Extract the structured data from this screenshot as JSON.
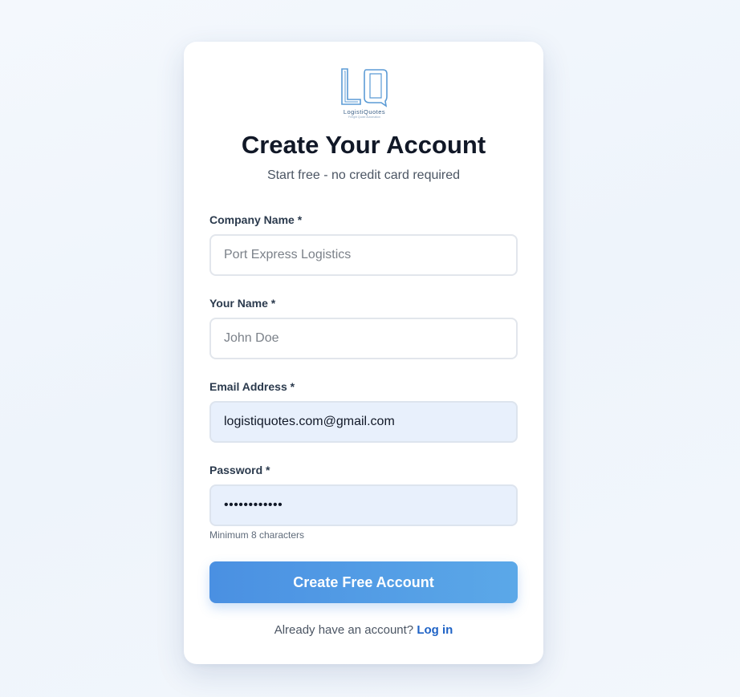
{
  "brand": {
    "logo_icon": "lq-monogram-logo",
    "logo_text": "LogistiQuotes",
    "logo_tagline": "Freight Quote Automation",
    "colors": {
      "logo": "#5b9bd5",
      "primary": "#4a90e2",
      "link": "#1f63c6"
    }
  },
  "header": {
    "title": "Create Your Account",
    "subtitle": "Start free - no credit card required"
  },
  "form": {
    "company": {
      "label": "Company Name",
      "required_mark": "*",
      "placeholder": "Port Express Logistics",
      "value": ""
    },
    "name": {
      "label": "Your Name",
      "required_mark": "*",
      "placeholder": "John Doe",
      "value": ""
    },
    "email": {
      "label": "Email Address",
      "required_mark": "*",
      "placeholder": "",
      "value": "logistiquotes.com@gmail.com"
    },
    "password": {
      "label": "Password",
      "required_mark": "*",
      "value": "passwordabcd",
      "hint": "Minimum 8 characters"
    },
    "submit_label": "Create Free Account"
  },
  "footer": {
    "prompt": "Already have an account?",
    "login_label": "Log in"
  }
}
